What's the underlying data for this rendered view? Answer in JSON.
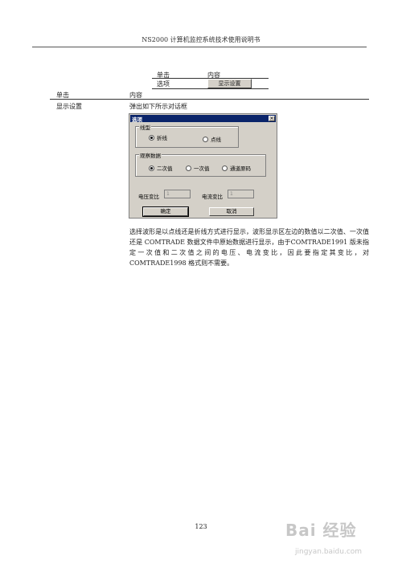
{
  "header": {
    "title": "NS2000 计算机监控系统技术使用说明书"
  },
  "table1": {
    "col1_header": "单击",
    "col2_header": "内容",
    "row1_col1": "选项",
    "row1_button": "显示设置"
  },
  "table2": {
    "col1_header": "单击",
    "col2_header": "内容",
    "row1_col1": "显示设置",
    "row1_col2": "弹出如下所示对话框"
  },
  "dialog": {
    "title": "选项",
    "close_glyph": "×",
    "group1": {
      "label": "线型",
      "opt1": "折线",
      "opt2": "点线",
      "selected": "折线"
    },
    "group2": {
      "label": "观察数据",
      "opt1": "二次值",
      "opt2": "一次值",
      "opt3": "通道原码",
      "selected": "二次值"
    },
    "voltage_label": "电压变比",
    "voltage_value": "1",
    "current_label": "电流变比",
    "current_value": "1",
    "ok_label": "确定",
    "cancel_label": "取消"
  },
  "body": {
    "paragraph": "选择波形是以点线还是折线方式进行显示，波形显示区左边的数值以二次值、一次值还是 COMTRADE 数据文件中原始数据进行显示，由于COMTRADE1991 版未指定一次值和二次值之间的电压、电流变比，因此要指定其变比，对 COMTRADE1998 格式则不需要。"
  },
  "footer": {
    "page_number": "123"
  },
  "watermark": {
    "brand": "Bai 经验",
    "url": "jingyan.baidu.com"
  }
}
